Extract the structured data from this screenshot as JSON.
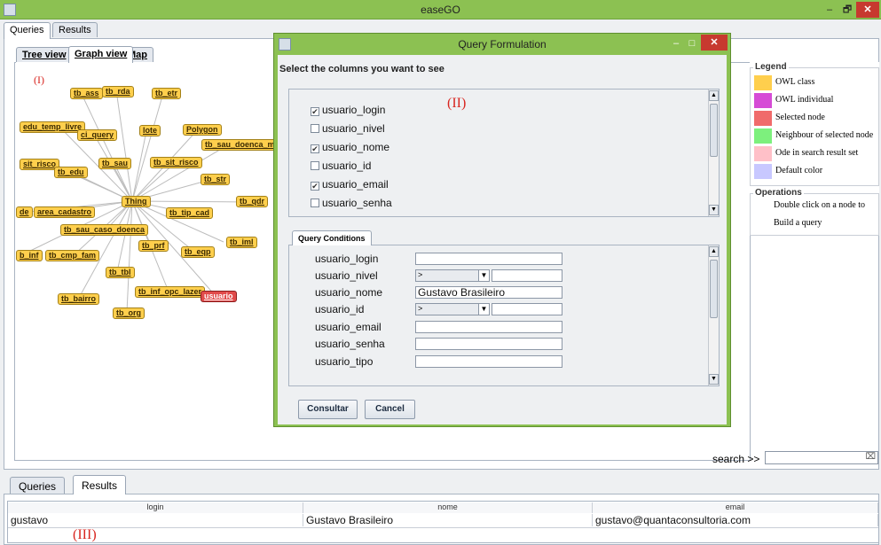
{
  "window": {
    "title": "easeGO",
    "controls": {
      "minimize": "–",
      "maximize": "🗗",
      "close": "✕"
    }
  },
  "top_tabs": [
    "Queries",
    "Results"
  ],
  "view_tabs": [
    "Tree view",
    "Graph view",
    "Map"
  ],
  "graph": {
    "annotation": "(I)",
    "center_node": "Thing",
    "nodes": [
      "tb_ass",
      "tb_rda",
      "tb_etr",
      "edu_temp_livre",
      "ci_query",
      "lote",
      "Polygon",
      "tb_sau_doenca_m",
      "sit_risco",
      "tb_edu",
      "tb_sau",
      "tb_sit_risco",
      "tb_str",
      "tb_qdr",
      "de",
      "area_cadastro",
      "tb_tip_cad",
      "tb_sau_caso_doenca",
      "tb_iml",
      "tb_prf",
      "b_inf",
      "tb_cmp_fam",
      "tb_eqp",
      "tb_tbl",
      "tb_inf_opc_lazer",
      "usuario",
      "tb_bairro",
      "tb_org"
    ],
    "selected_node": "usuario"
  },
  "legend": {
    "title": "Legend",
    "items": [
      {
        "label": "OWL class",
        "color": "#ffcf4d"
      },
      {
        "label": "OWL individual",
        "color": "#d64bd6"
      },
      {
        "label": "Selected node",
        "color": "#f06b6b"
      },
      {
        "label": "Neighbour of selected node",
        "color": "#7df07d"
      },
      {
        "label": "Ode in search result set",
        "color": "#ffc0c8"
      },
      {
        "label": "Default color",
        "color": "#c8c8ff"
      }
    ],
    "operations_title": "Operations",
    "operations_lines": [
      "Double click on a node to",
      "Build a query"
    ]
  },
  "dialog": {
    "title": "Query Formulation",
    "controls": {
      "minimize": "–",
      "maximize": "□",
      "close": "✕"
    },
    "columns_heading": "Select the columns you want to see",
    "annotation": "(II)",
    "columns": [
      {
        "label": "usuario_login",
        "checked": "✔"
      },
      {
        "label": "usuario_nivel",
        "checked": ""
      },
      {
        "label": "usuario_nome",
        "checked": "✔"
      },
      {
        "label": "usuario_id",
        "checked": ""
      },
      {
        "label": "usuario_email",
        "checked": "✔"
      },
      {
        "label": "usuario_senha",
        "checked": ""
      }
    ],
    "conditions_tab": "Query Conditions",
    "conditions": [
      {
        "label": "usuario_login",
        "value": ""
      },
      {
        "label": "usuario_nivel",
        "operator": ">",
        "value": ""
      },
      {
        "label": "usuario_nome",
        "value": "Gustavo Brasileiro"
      },
      {
        "label": "usuario_id",
        "operator": ">",
        "value": ""
      },
      {
        "label": "usuario_email",
        "value": ""
      },
      {
        "label": "usuario_senha",
        "value": ""
      },
      {
        "label": "usuario_tipo",
        "value": ""
      }
    ],
    "buttons": {
      "submit": "Consultar",
      "cancel": "Cancel"
    }
  },
  "search": {
    "label": "search >>",
    "value": "",
    "clear_icon": "⌧"
  },
  "bottom_tabs": [
    "Queries",
    "Results"
  ],
  "results": {
    "annotation": "(III)",
    "columns": [
      "login",
      "nome",
      "email"
    ],
    "rows": [
      [
        "gustavo",
        "Gustavo Brasileiro",
        "gustavo@quantaconsultoria.com"
      ]
    ]
  }
}
